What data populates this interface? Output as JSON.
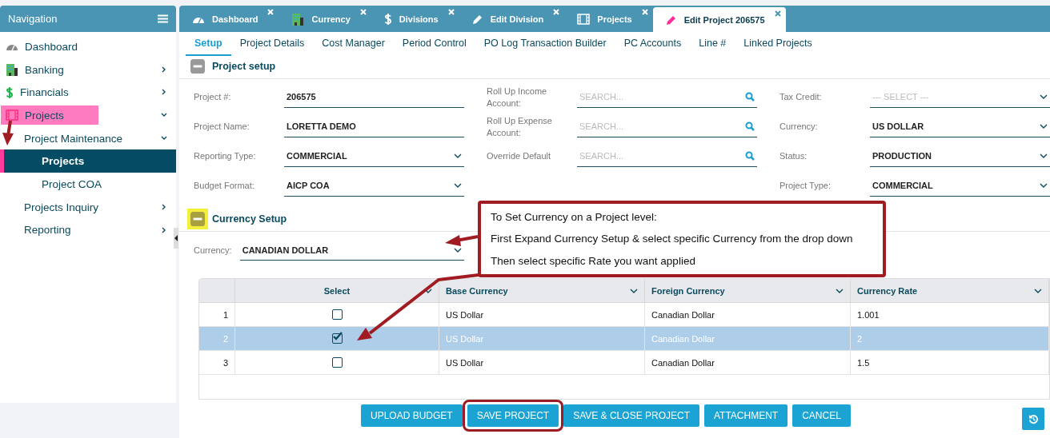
{
  "navigation": {
    "title": "Navigation",
    "items": [
      {
        "label": "Dashboard",
        "kind": "gauge",
        "selected": false,
        "highlighted": false
      },
      {
        "label": "Banking",
        "kind": "building",
        "expanded": false,
        "selected": false,
        "highlighted": false
      },
      {
        "label": "Financials",
        "kind": "dollar",
        "expanded": false,
        "selected": false,
        "highlighted": false
      },
      {
        "label": "Projects",
        "kind": "film",
        "expanded": true,
        "selected": false,
        "highlighted": true,
        "children": [
          {
            "label": "Project Maintenance",
            "expanded": true,
            "selected": false,
            "highlighted": false,
            "children": [
              {
                "label": "Projects",
                "selected": true,
                "highlighted": false
              },
              {
                "label": "Project COA",
                "selected": false,
                "highlighted": false
              }
            ]
          },
          {
            "label": "Projects Inquiry",
            "expanded": false,
            "selected": false,
            "highlighted": false
          },
          {
            "label": "Reporting",
            "expanded": false,
            "selected": false,
            "highlighted": false
          }
        ]
      }
    ]
  },
  "tabs": [
    {
      "label": "Dashboard",
      "kind": "gauge",
      "selected": false
    },
    {
      "label": "Currency",
      "kind": "building",
      "selected": false
    },
    {
      "label": "Divisions",
      "kind": "dollar",
      "selected": false
    },
    {
      "label": "Edit Division",
      "kind": "pencil",
      "selected": false
    },
    {
      "label": "Projects",
      "kind": "film",
      "selected": false
    },
    {
      "label": "Edit Project 206575",
      "kind": "pencil",
      "selected": true
    }
  ],
  "subtabs": [
    {
      "label": "Setup",
      "selected": true
    },
    {
      "label": "Project Details",
      "selected": false
    },
    {
      "label": "Cost Manager",
      "selected": false
    },
    {
      "label": "Period Control",
      "selected": false
    },
    {
      "label": "PO Log Transaction Builder",
      "selected": false
    },
    {
      "label": "PC Accounts",
      "selected": false
    },
    {
      "label": "Line #",
      "selected": false
    },
    {
      "label": "Linked Projects",
      "selected": false
    }
  ],
  "project_setup": {
    "title": "Project setup",
    "expanded": true,
    "highlighted": false,
    "columns": [
      [
        {
          "label": "Project #:",
          "kind": "text",
          "value": "206575"
        },
        {
          "label": "Project Name:",
          "kind": "text",
          "value": "LORETTA DEMO"
        },
        {
          "label": "Reporting Type:",
          "kind": "select",
          "value": "COMMERCIAL"
        },
        {
          "label": "Budget Format:",
          "kind": "select",
          "value": "AICP COA"
        }
      ],
      [
        {
          "label": "Roll Up Income Account:",
          "kind": "search",
          "placeholder": "SEARCH..."
        },
        {
          "label": "Roll Up Expense Account:",
          "kind": "search",
          "placeholder": "SEARCH..."
        },
        {
          "label": "Override Default",
          "kind": "search",
          "placeholder": "SEARCH..."
        }
      ],
      [
        {
          "label": "Tax Credit:",
          "kind": "select",
          "placeholder": "--- SELECT ---"
        },
        {
          "label": "Currency:",
          "kind": "select",
          "value": "US DOLLAR"
        },
        {
          "label": "Status:",
          "kind": "select",
          "value": "PRODUCTION"
        },
        {
          "label": "Project Type:",
          "kind": "select",
          "value": "COMMERCIAL"
        }
      ]
    ]
  },
  "currency_setup": {
    "title": "Currency Setup",
    "expanded": true,
    "highlighted": true,
    "currency": {
      "label": "Currency:",
      "value": "CANADIAN DOLLAR"
    },
    "table": {
      "columns": [
        "Select",
        "Base Currency",
        "Foreign Currency",
        "Currency Rate"
      ],
      "rows": [
        {
          "number": "1",
          "checked": false,
          "selected": false,
          "base": "US Dollar",
          "foreign": "Canadian Dollar",
          "rate": "1.001"
        },
        {
          "number": "2",
          "checked": true,
          "selected": true,
          "base": "US Dollar",
          "foreign": "Canadian Dollar",
          "rate": "2"
        },
        {
          "number": "3",
          "checked": false,
          "selected": false,
          "base": "US Dollar",
          "foreign": "Canadian Dollar",
          "rate": "1.5"
        }
      ]
    }
  },
  "buttons": [
    {
      "label": "UPLOAD BUDGET",
      "outlined": false
    },
    {
      "label": "SAVE PROJECT",
      "outlined": true
    },
    {
      "label": "SAVE & CLOSE PROJECT",
      "outlined": false
    },
    {
      "label": "ATTACHMENT",
      "outlined": false
    },
    {
      "label": "CANCEL",
      "outlined": false
    }
  ],
  "callout": {
    "lines": [
      "To Set Currency on a Project level:",
      "First Expand Currency Setup & select specific Currency from the drop down",
      "Then select specific Rate you want applied"
    ]
  }
}
